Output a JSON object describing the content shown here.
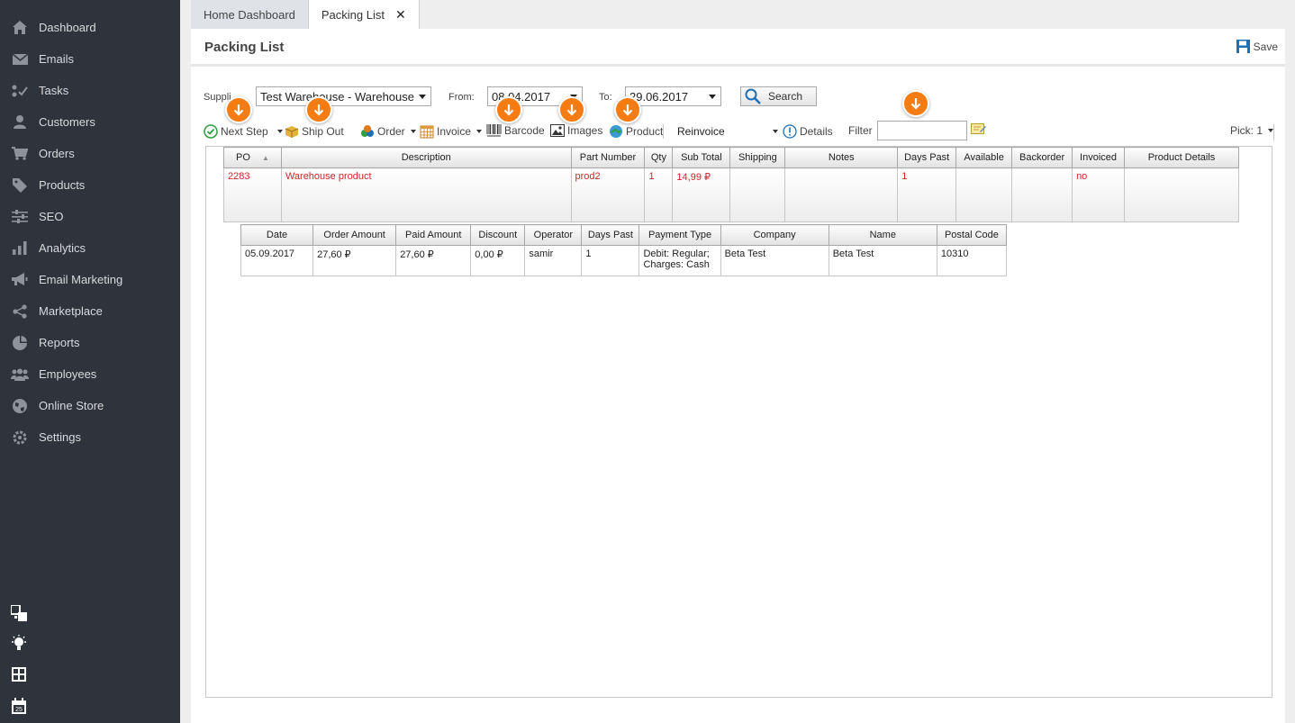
{
  "sidebar": {
    "items": [
      {
        "label": "Dashboard",
        "icon": "home-icon"
      },
      {
        "label": "Emails",
        "icon": "envelope-icon"
      },
      {
        "label": "Tasks",
        "icon": "tasks-icon"
      },
      {
        "label": "Customers",
        "icon": "user-icon"
      },
      {
        "label": "Orders",
        "icon": "cart-icon"
      },
      {
        "label": "Products",
        "icon": "tag-icon"
      },
      {
        "label": "SEO",
        "icon": "sliders-icon"
      },
      {
        "label": "Analytics",
        "icon": "bar-chart-icon"
      },
      {
        "label": "Email Marketing",
        "icon": "megaphone-icon"
      },
      {
        "label": "Marketplace",
        "icon": "share-icon"
      },
      {
        "label": "Reports",
        "icon": "pie-chart-icon"
      },
      {
        "label": "Employees",
        "icon": "users-icon"
      },
      {
        "label": "Online Store",
        "icon": "globe-icon"
      },
      {
        "label": "Settings",
        "icon": "gear-icon"
      }
    ]
  },
  "tabs": [
    {
      "label": "Home Dashboard"
    },
    {
      "label": "Packing List"
    }
  ],
  "header": {
    "title": "Packing List",
    "save_label": "Save"
  },
  "filters": {
    "supplier_label": "Suppli",
    "supplier_value": "Test Warehouse - Warehouse",
    "from_label": "From:",
    "from_value": "08.04.2017",
    "to_label": "To:",
    "to_value": "29.06.2017",
    "search_label": "Search"
  },
  "toolbar": {
    "next_step": "Next Step",
    "ship_out": "Ship Out",
    "order": "Order",
    "invoice": "Invoice",
    "barcode": "Barcode",
    "images": "Images",
    "product": "Product",
    "reinvoice": "Reinvoice",
    "details": "Details",
    "filter_label": "Filter",
    "pick": "Pick: 1"
  },
  "main_grid": {
    "columns": [
      "PO",
      "Description",
      "Part Number",
      "Qty",
      "Sub Total",
      "Shipping",
      "Notes",
      "Days Past",
      "Available",
      "Backorder",
      "Invoiced",
      "Product Details"
    ],
    "rows": [
      [
        "2283",
        "Warehouse product",
        "prod2",
        "1",
        "14,99 ₽",
        "",
        "",
        "1",
        "",
        "",
        "no",
        ""
      ]
    ]
  },
  "sub_grid": {
    "columns": [
      "Date",
      "Order Amount",
      "Paid Amount",
      "Discount",
      "Operator",
      "Days Past",
      "Payment Type",
      "Company",
      "Name",
      "Postal Code"
    ],
    "rows": [
      [
        "05.09.2017",
        "27,60 ₽",
        "27,60 ₽",
        "0,00 ₽",
        "samir",
        "1",
        "Debit: Regular; Charges: Cash",
        "Beta Test",
        "Beta Test",
        "10310"
      ]
    ]
  },
  "colors": {
    "sidebar_bg": "#2f333b",
    "marker_orange": "#f57c12",
    "row_text_red": "#d2232a"
  }
}
